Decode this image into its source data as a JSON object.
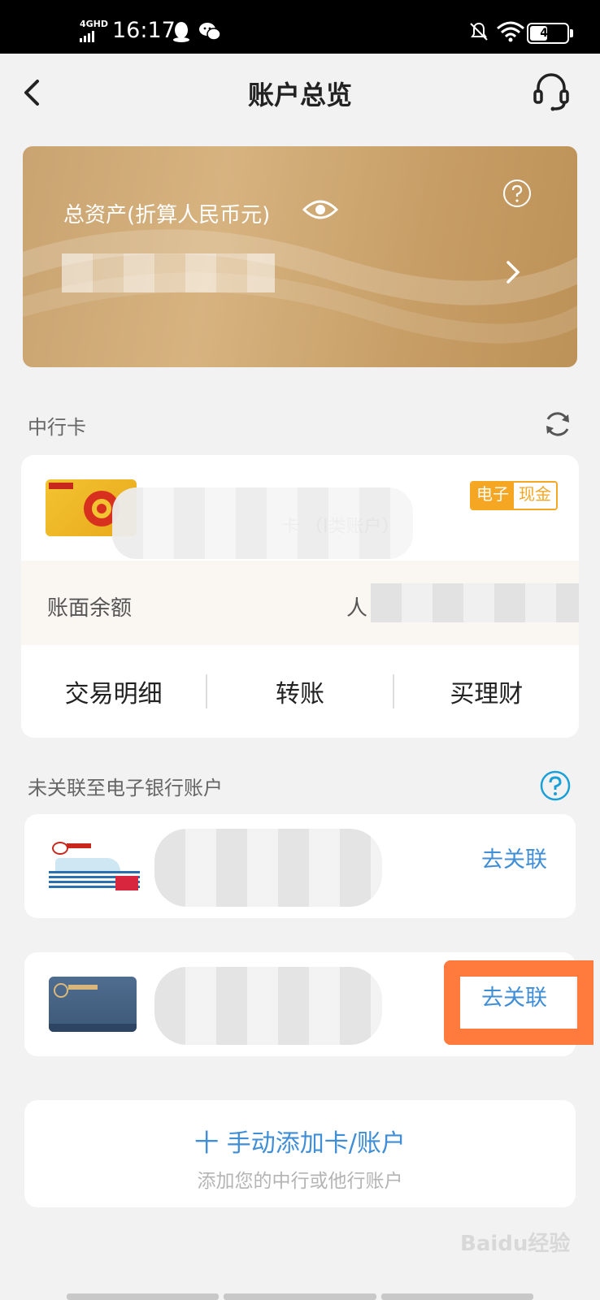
{
  "status_bar": {
    "network": "4GHD",
    "time": "16:17",
    "battery": "44"
  },
  "header": {
    "title": "账户总览"
  },
  "asset_card": {
    "label": "总资产(折算人民币元)"
  },
  "boc_section": {
    "label": "中行卡",
    "card": {
      "tag_left": "电子",
      "tag_right": "现金",
      "account_type": "卡 （Ⅰ类账户）",
      "balance_label": "账面余额",
      "balance_prefix": "人",
      "actions": [
        "交易明细",
        "转账",
        "买理财"
      ]
    }
  },
  "unlinked_section": {
    "label": "未关联至电子银行账户",
    "items": [
      {
        "link_label": "去关联"
      },
      {
        "link_label": "去关联"
      }
    ]
  },
  "add_card": {
    "title": "十 手动添加卡/账户",
    "subtitle": "添加您的中行或他行账户"
  },
  "watermark": "Baidu经验",
  "colors": {
    "accent_blue": "#3f8ed6",
    "gold": "#c9a471",
    "tag_orange": "#f5a623",
    "highlight": "#ff7a3d"
  },
  "icons": [
    "back-arrow-icon",
    "headset-icon",
    "eye-icon",
    "question-icon",
    "chevron-right-icon",
    "refresh-icon",
    "question-blue-icon"
  ]
}
